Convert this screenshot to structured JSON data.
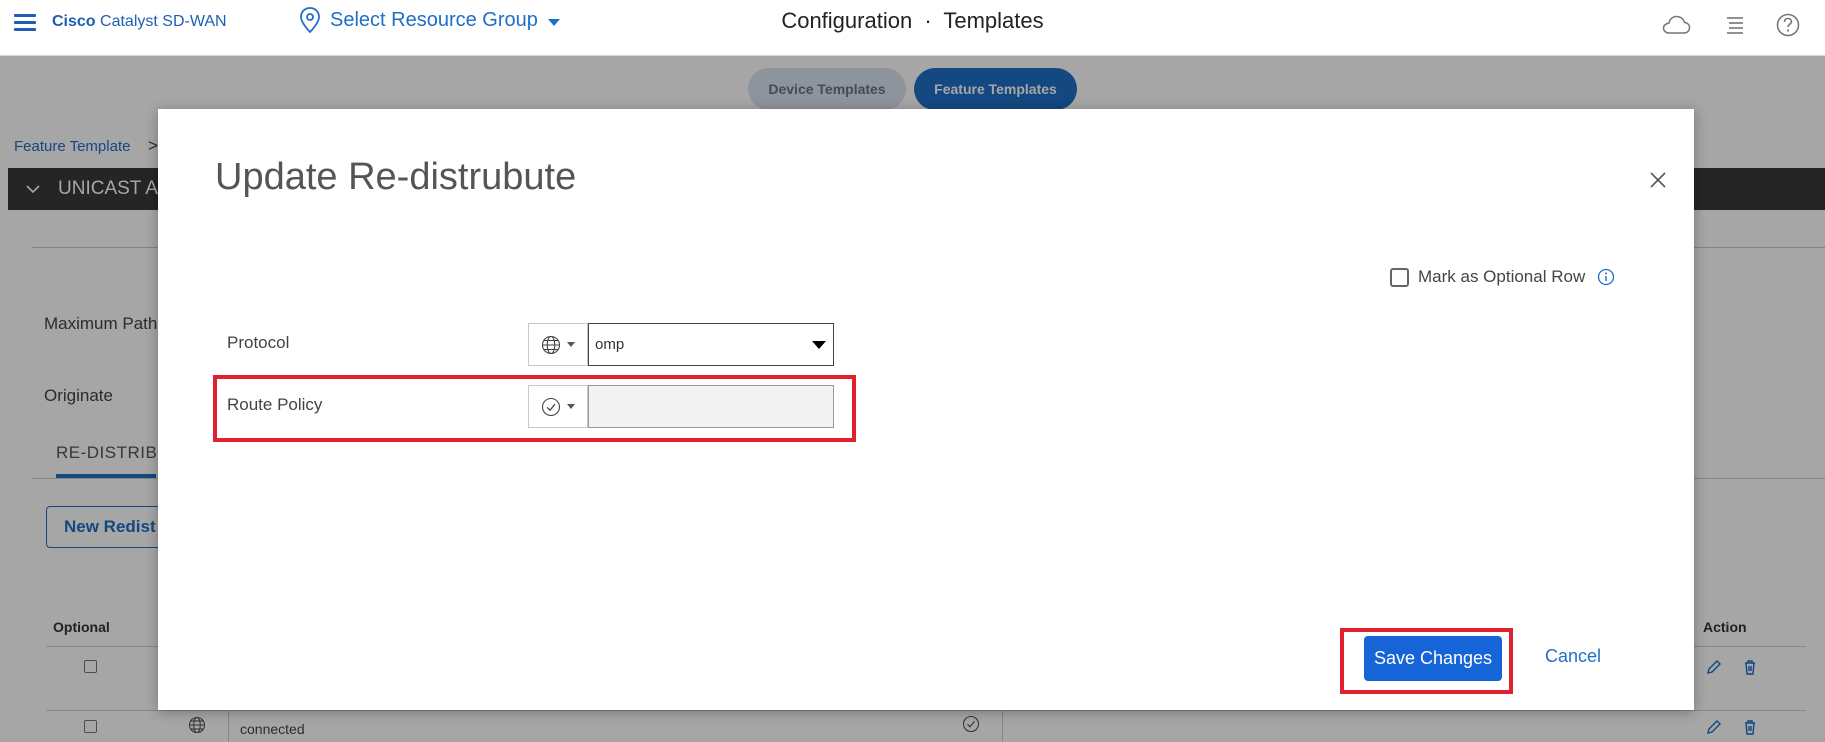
{
  "header": {
    "brand_bold": "Cisco",
    "brand_rest": "Catalyst SD-WAN",
    "resource_group": "Select Resource Group",
    "title_left": "Configuration",
    "title_sep": "·",
    "title_right": "Templates"
  },
  "tabs": [
    {
      "label": "Device Templates",
      "active": false
    },
    {
      "label": "Feature Templates",
      "active": true
    }
  ],
  "breadcrumb": {
    "first": "Feature Template",
    "sep": ">"
  },
  "section_bar": {
    "title": "UNICAST A"
  },
  "form_bg": {
    "max_paths_label": "Maximum Path",
    "originate_label": "Originate",
    "redist_tab": "RE-DISTRIBU",
    "new_button": "New Redist"
  },
  "table": {
    "headers": {
      "optional": "Optional",
      "action": "Action"
    },
    "rows": [
      {
        "protocol": ""
      },
      {
        "protocol": "connected"
      }
    ]
  },
  "modal": {
    "title": "Update Re-distrubute",
    "optional_row_label": "Mark as Optional Row",
    "fields": {
      "protocol": {
        "label": "Protocol",
        "value": "omp"
      },
      "route_policy": {
        "label": "Route Policy",
        "value": ""
      }
    },
    "save_label": "Save Changes",
    "cancel_label": "Cancel"
  },
  "colors": {
    "accent": "#1e6fc7",
    "primary_button": "#1565d8",
    "highlight": "#e0222e",
    "section_bar": "#3a3a3a"
  },
  "icons": {
    "menu": "hamburger-icon",
    "resource": "location-pin-icon",
    "cloud": "cloud-icon",
    "list": "list-icon",
    "help": "help-icon",
    "global_scope": "globe-icon",
    "device_scope": "check-circle-icon",
    "close": "close-icon",
    "info": "info-icon",
    "edit": "pencil-icon",
    "delete": "trash-icon"
  }
}
